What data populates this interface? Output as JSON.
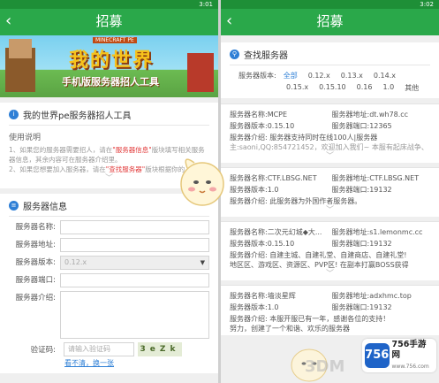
{
  "left": {
    "status_time": "3:01",
    "title": "招募",
    "back_icon": "chevron-left-icon",
    "banner": {
      "main": "我的世界",
      "sub": "手机版服务器招人工具",
      "tag": "MINECRAFT PE"
    },
    "tool_card": {
      "heading": "我的世界pe服务器招人工具",
      "usage_title": "使用说明",
      "line1_a": "1、如果您的服务器需要招人，请在",
      "line1_hl": "\"服务器信息\"",
      "line1_b": "版块填写相关服务器信息，其余内容可在服务器介绍里。",
      "line2_a": "2、如果您想要加入服务器，请在",
      "line2_hl": "\"查找服务器\"",
      "line2_b": "版块根据你的"
    },
    "info_card": {
      "heading": "服务器信息",
      "name_label": "服务器名称:",
      "addr_label": "服务器地址:",
      "version_label": "服务器版本:",
      "version_value": "0.12.x",
      "port_label": "服务器端口:",
      "intro_label": "服务器介绍:",
      "captcha_label": "验证码:",
      "captcha_placeholder": "请输入验证码",
      "captcha_text": "3eZk",
      "captcha_link": "看不清，换一张"
    }
  },
  "right": {
    "status_time": "3:02",
    "title": "招募",
    "search_heading": "查找服务器",
    "filter_label": "服务器版本:",
    "filter_row1": [
      "全部",
      "0.12.x",
      "0.13.x",
      "0.14.x"
    ],
    "filter_row2": [
      "0.15.x",
      "0.15.10",
      "0.16",
      "1.0",
      "其他"
    ],
    "servers": [
      {
        "name": "服务器名称:MCPE",
        "addr": "服务器地址:dt.wh78.cc",
        "ver": "服务器版本:0.15.10",
        "port": "服务器端口:12365",
        "intro": "服务器介绍: 服务器支持同时在线100人|服务器",
        "intro2": "主:saoni,QQ:854721452，欢迎加入我们~ 本服有起床战争、"
      },
      {
        "name": "服务器名称:CTF.LBSG.NET",
        "addr": "服务器地址:CTF.LBSG.NET",
        "ver": "服务器版本:1.0",
        "port": "服务器端口:19132",
        "intro": "服务器介绍: 此服务器为外国作者服务器。",
        "intro2": ""
      },
      {
        "name": "服务器名称:二次元幻城◆大...",
        "addr": "服务器地址:s1.lemonmc.cc",
        "ver": "服务器版本:0.15.10",
        "port": "服务器端口:19132",
        "intro": "服务器介绍: 自建主城、自建礼堂、自建商店、自建礼堂!",
        "intro2": "地区区、游戏区、资源区、PVP区! 在副本打赢BOSS获得"
      },
      {
        "name": "服务器名称:墙淡星辉",
        "addr": "服务器地址:adxhmc.top",
        "ver": "服务器版本:1.0",
        "port": "服务器端口:19132",
        "intro": "服务器介绍: 本服开服已有一年，感谢各位的支持！",
        "intro2": "努力，创建了一个和谐、欢乐的服务器"
      }
    ]
  },
  "watermark": "3DM",
  "badge": {
    "icon": "756",
    "name": "756手游网",
    "sub": "www.756.com"
  },
  "colors": {
    "green": "#2aa84a",
    "accent": "#2e7fd6",
    "highlight": "#e23a3a"
  }
}
